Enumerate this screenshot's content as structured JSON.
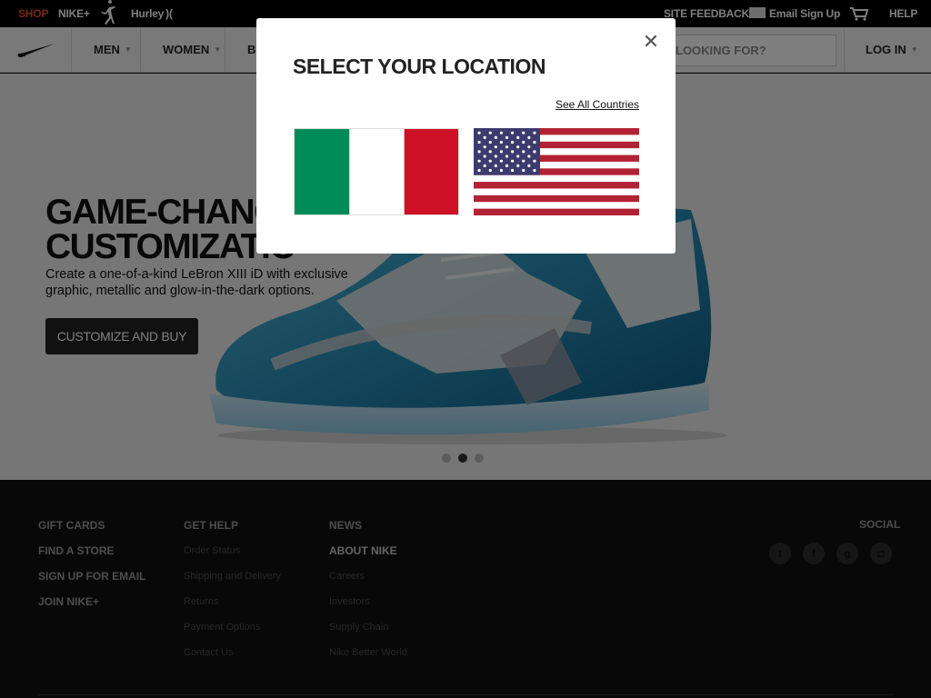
{
  "topbar": {
    "shop": "SHOP",
    "nikeplus": "NIKE+",
    "hurley": "Hurley",
    "site_feedback": "SITE FEEDBACK",
    "email_signup": "Email Sign Up",
    "help": "HELP",
    "icons": [
      "jordan-jumpman-icon",
      "mail-icon",
      "cart-icon"
    ],
    "shop_color": "#f4501b"
  },
  "nav": {
    "items": [
      {
        "label": "MEN"
      },
      {
        "label": "WOMEN"
      },
      {
        "label": "BO"
      }
    ],
    "search_text": "LOOKING FOR?",
    "login": "LOG IN",
    "logo_icon": "nike-swoosh-icon"
  },
  "hero": {
    "headline_1": "GAME-CHANGI",
    "headline_2": "CUSTOMIZATIO",
    "subtext": "Create a one-of-a-kind LeBron XIII iD with exclusive graphic, metallic and glow-in-the-dark options.",
    "cta": "CUSTOMIZE AND BUY",
    "carousel": {
      "slides": 3,
      "active": 2
    }
  },
  "footer": {
    "col1": [
      "GIFT CARDS",
      "FIND A STORE",
      "SIGN UP FOR EMAIL",
      "JOIN NIKE+"
    ],
    "col2_heading": "GET HELP",
    "col2_links": [
      "Order Status",
      "Shipping and Delivery",
      "Returns",
      "Payment Options",
      "Contact Us"
    ],
    "col3_news": "NEWS",
    "col3_heading": "ABOUT NIKE",
    "col3_links": [
      "Careers",
      "Investors",
      "Supply Chain",
      "Nike Better World"
    ],
    "social_heading": "SOCIAL",
    "social_icons": [
      "twitter-icon",
      "facebook-icon",
      "google-plus-icon",
      "instagram-icon"
    ]
  },
  "modal": {
    "title": "SELECT YOUR LOCATION",
    "see_all": "See All Countries",
    "close_icon": "close-icon",
    "countries": [
      {
        "flag_icon": "italy-flag-icon",
        "colors": [
          "#008c5a",
          "#ffffff",
          "#ce1126"
        ]
      },
      {
        "flag_icon": "usa-flag-icon",
        "colors": [
          "#b22234",
          "#ffffff",
          "#3c3b6e"
        ]
      }
    ]
  }
}
